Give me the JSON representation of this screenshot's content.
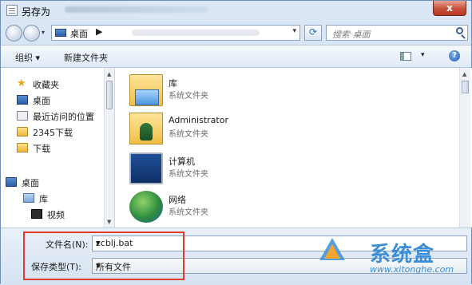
{
  "window": {
    "title": "另存为",
    "close_glyph": "x"
  },
  "nav": {
    "address": "桌面",
    "address_separator": "▶",
    "search_placeholder": "搜索 桌面"
  },
  "toolbar": {
    "organize": "组织 ▾",
    "new_folder": "新建文件夹"
  },
  "sidebar": {
    "items": [
      {
        "label": "收藏夹",
        "icon": "star-icon"
      },
      {
        "label": "桌面",
        "icon": "desktop-icon"
      },
      {
        "label": "最近访问的位置",
        "icon": "recent-places-icon"
      },
      {
        "label": "2345下载",
        "icon": "folder-icon"
      },
      {
        "label": "下载",
        "icon": "downloads-icon"
      },
      {
        "label": "桌面",
        "icon": "desktop-icon"
      },
      {
        "label": "库",
        "icon": "library-icon"
      },
      {
        "label": "视频",
        "icon": "video-icon"
      }
    ]
  },
  "files": [
    {
      "name": "库",
      "type": "系统文件夹",
      "icon": "library-folder-icon"
    },
    {
      "name": "Administrator",
      "type": "系统文件夹",
      "icon": "user-folder-icon"
    },
    {
      "name": "计算机",
      "type": "系统文件夹",
      "icon": "computer-icon"
    },
    {
      "name": "网络",
      "type": "系统文件夹",
      "icon": "network-icon"
    }
  ],
  "form": {
    "filename_label": "文件名(N):",
    "filename_value": "zcblj.bat",
    "savetype_label": "保存类型(T):",
    "savetype_value": "所有文件"
  },
  "watermark": {
    "brand": "系统盒",
    "url": "www.xitonghe.com"
  },
  "colors": {
    "highlight_box": "#e23b2e",
    "accent": "#3a8fd8"
  }
}
